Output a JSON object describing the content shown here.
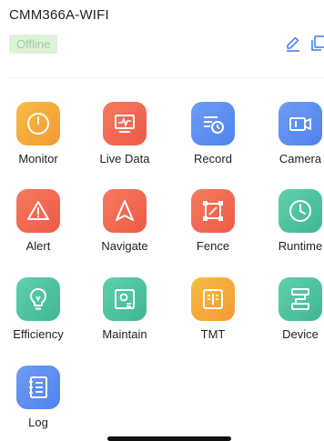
{
  "header": {
    "device_name": "CMM366A-WIFI",
    "status": "Offline",
    "edit_icon": "edit-icon",
    "copy_icon": "copy-icon",
    "accent_color": "#3a78f2"
  },
  "tiles": [
    {
      "label": "Monitor",
      "icon": "gauge-icon",
      "color": "#f5a53a"
    },
    {
      "label": "Live Data",
      "icon": "live-chart-icon",
      "color": "#f0664d"
    },
    {
      "label": "Record",
      "icon": "record-list-icon",
      "color": "#5c8ff0"
    },
    {
      "label": "Camera",
      "icon": "camera-icon",
      "color": "#5c8ff0"
    },
    {
      "label": "Alert",
      "icon": "alert-triangle-icon",
      "color": "#f0664d"
    },
    {
      "label": "Navigate",
      "icon": "navigate-arrow-icon",
      "color": "#f0664d"
    },
    {
      "label": "Fence",
      "icon": "fence-square-icon",
      "color": "#f0664d"
    },
    {
      "label": "Runtime",
      "icon": "clock-icon",
      "color": "#4fc3a0"
    },
    {
      "label": "Efficiency",
      "icon": "lightbulb-icon",
      "color": "#4fc3a0"
    },
    {
      "label": "Maintain",
      "icon": "maintain-screen-icon",
      "color": "#4fc3a0"
    },
    {
      "label": "TMT",
      "icon": "tmt-panel-icon",
      "color": "#f5a53a"
    },
    {
      "label": "Device",
      "icon": "device-link-icon",
      "color": "#4fc3a0"
    },
    {
      "label": "Log",
      "icon": "log-book-icon",
      "color": "#5c8ff0"
    }
  ]
}
